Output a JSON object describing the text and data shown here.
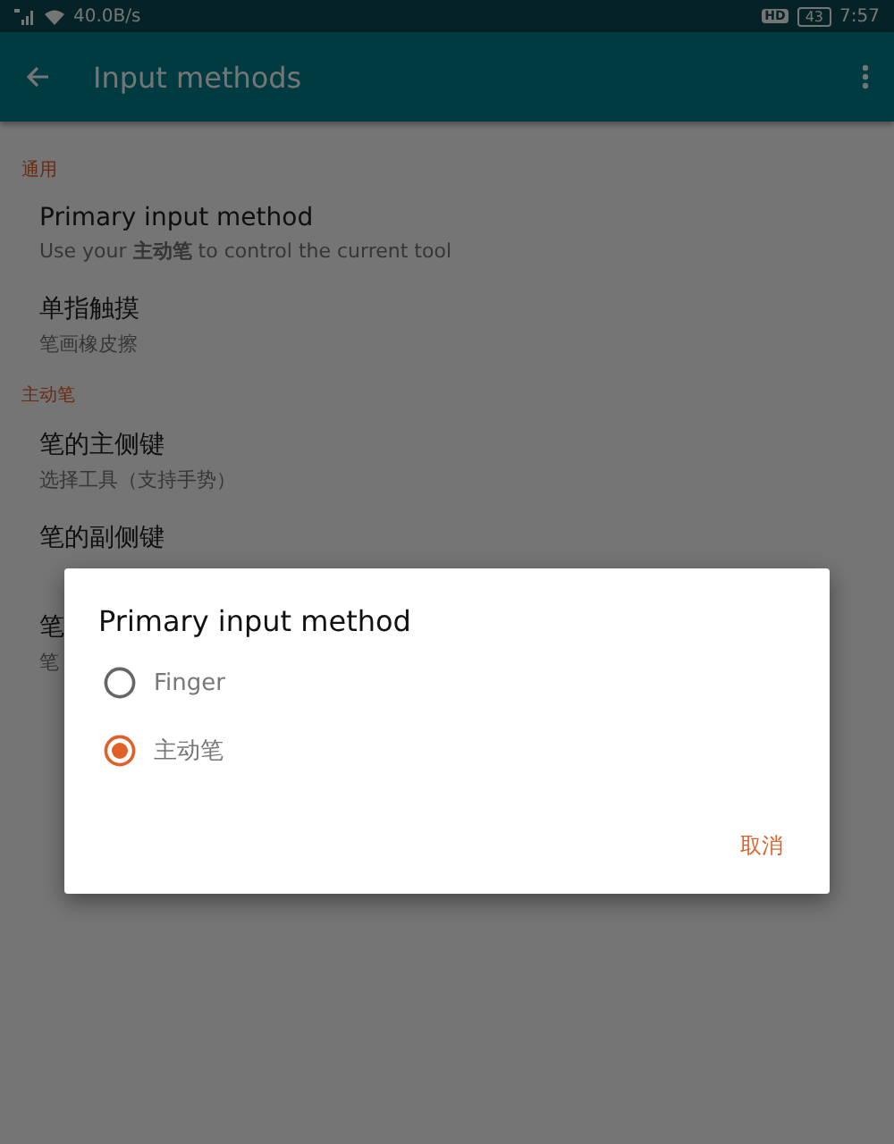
{
  "status_bar": {
    "network_speed": "40.0B/s",
    "hd_badge": "HD",
    "battery": "43",
    "time": "7:57"
  },
  "app_bar": {
    "title": "Input methods"
  },
  "sections": [
    {
      "header": "通用",
      "items": [
        {
          "title": "Primary input method",
          "subtitle": "Use your **主动笔** to control the current tool"
        },
        {
          "title": "单指触摸",
          "subtitle": "笔画橡皮擦"
        }
      ]
    },
    {
      "header": "主动笔",
      "items": [
        {
          "title": "笔的主侧键",
          "subtitle": "选择工具（支持手势）"
        },
        {
          "title": "笔的副侧键"
        },
        {
          "title": "笔",
          "subtitle": "笔"
        }
      ]
    }
  ],
  "dialog": {
    "title": "Primary input method",
    "options": [
      {
        "label": "Finger",
        "selected": false
      },
      {
        "label": "主动笔",
        "selected": true
      }
    ],
    "buttons": [
      "取消"
    ]
  }
}
